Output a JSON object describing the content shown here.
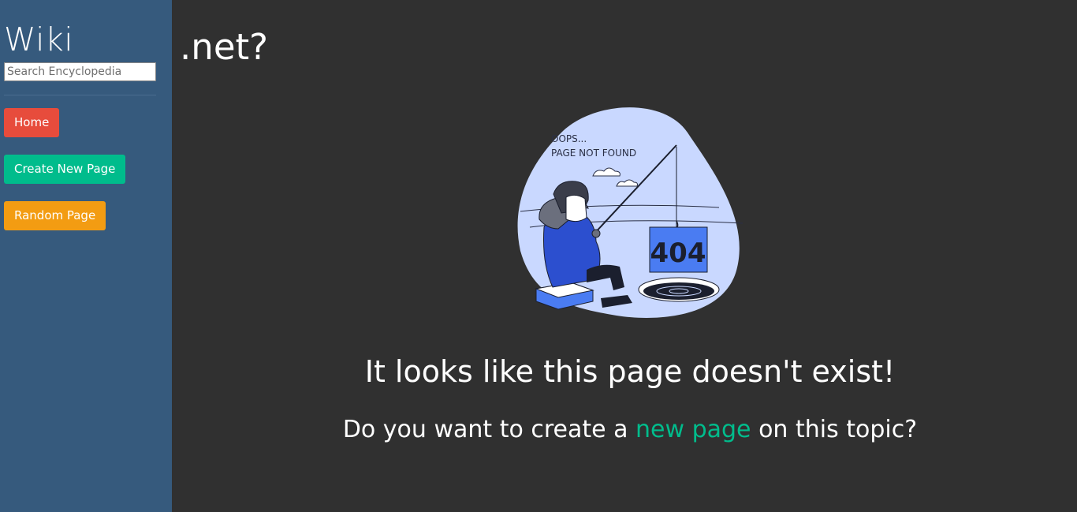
{
  "sidebar": {
    "brand": "Wiki",
    "search": {
      "placeholder": "Search Encyclopedia",
      "value": ""
    },
    "buttons": {
      "home": "Home",
      "create": "Create New Page",
      "random": "Random Page"
    }
  },
  "main": {
    "title": ".net?",
    "illustration": {
      "caption_line1": "OOPS...",
      "caption_line2": "PAGE NOT FOUND",
      "sign_code": "404"
    },
    "headline": "It looks like this page doesn't exist!",
    "subline_before": "Do you want to create a",
    "subline_link": "new page",
    "subline_after": "on this topic?"
  },
  "colors": {
    "sidebar_bg": "#365a7d",
    "main_bg": "#303030",
    "home_button": "#e74c3c",
    "create_button": "#00bc8c",
    "random_button": "#f39c12",
    "link": "#00bc8c"
  }
}
